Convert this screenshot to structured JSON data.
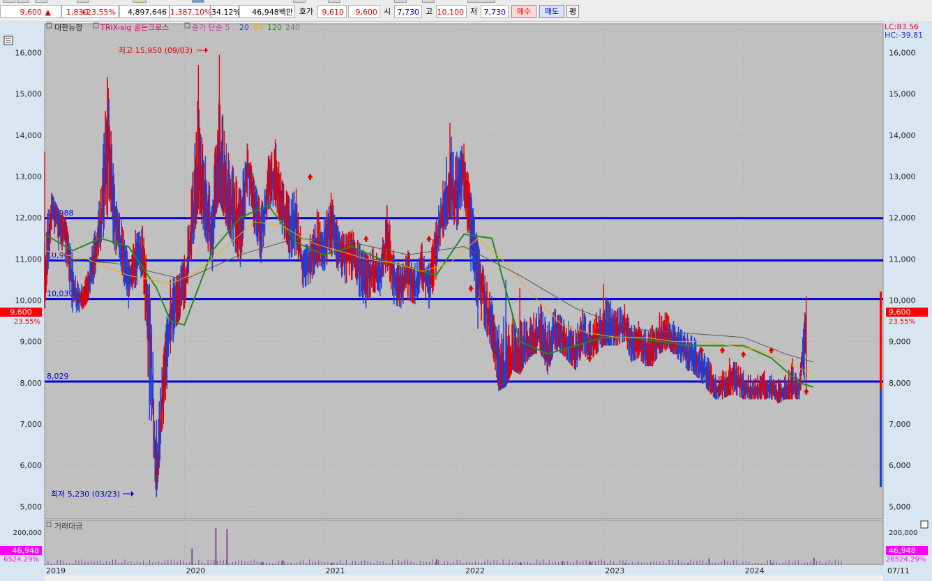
{
  "quote": {
    "price": "9,600",
    "arrow": "▲",
    "change": "1,830",
    "change_pct": "+23.55%",
    "volume": "4,897,646",
    "vol_ratio": "1,387.10%",
    "turnover_pct": "34.12%",
    "amount": "46,948백만",
    "hoga_label": "호가",
    "ask": "9,610",
    "bid": "9,600",
    "open_label": "시",
    "open": "7,730",
    "high_label": "고",
    "high": "10,100",
    "low_label": "저",
    "low": "7,730",
    "buy_label": "매수",
    "sell_label": "매도",
    "avg_label": "평"
  },
  "legend": {
    "group": "대한뉴팜",
    "trix": "TRIX-sig 골든크로스",
    "ma_label": "종가 단순 5",
    "ma20": "20",
    "ma60": "60",
    "ma120": "120",
    "ma240": "240"
  },
  "indicator": {
    "lc": "LC:83.56",
    "hc": "HC:-39.81"
  },
  "annotations": {
    "high": "최고 15,950 (09/03)",
    "low": "최저 5,230 (03/23)"
  },
  "hlines": [
    {
      "value": 11988,
      "label": "11,988"
    },
    {
      "value": 10964,
      "label": "10,964"
    },
    {
      "value": 10030,
      "label": "10,030"
    },
    {
      "value": 8029,
      "label": "8,029"
    }
  ],
  "price_tag": {
    "value": "9,600",
    "pct": "23.55%"
  },
  "volume_panel": {
    "title": "거래대금",
    "tag": "46,948",
    "pct": "6524.29%",
    "pct_right": "26524.29%",
    "ytick": "200,000"
  },
  "colors": {
    "up": "#e00000",
    "down": "#1a3fd8",
    "hline": "#0000dd",
    "ma5": "#2233cc",
    "ma20": "#f0b000",
    "ma60": "#228822",
    "ma120": "#555555",
    "panel_bg": "#c0c0c0",
    "axis_bg": "#d8e6f2",
    "tag_red": "#ff0000",
    "tag_magenta": "#ff00ff"
  },
  "chart_data": {
    "type": "candlestick-line",
    "yticks": [
      "5,000",
      "6,000",
      "7,000",
      "8,000",
      "9,000",
      "10,000",
      "11,000",
      "12,000",
      "13,000",
      "14,000",
      "15,000",
      "16,000"
    ],
    "ylim": [
      4700,
      16700
    ],
    "xlabels": [
      {
        "label": "2019",
        "x": 2019.0
      },
      {
        "label": "2020",
        "x": 2020.0
      },
      {
        "label": "2021",
        "x": 2021.0
      },
      {
        "label": "2022",
        "x": 2022.0
      },
      {
        "label": "2023",
        "x": 2023.0
      },
      {
        "label": "2024",
        "x": 2024.0
      },
      {
        "label": "07/11",
        "x": 2024.95
      }
    ],
    "xlim": [
      2019.0,
      2025.0
    ],
    "price": {
      "x": [
        2019.0,
        2019.05,
        2019.1,
        2019.15,
        2019.2,
        2019.25,
        2019.3,
        2019.35,
        2019.4,
        2019.45,
        2019.5,
        2019.55,
        2019.6,
        2019.65,
        2019.7,
        2019.75,
        2019.8,
        2019.85,
        2019.9,
        2019.95,
        2020.0,
        2020.05,
        2020.1,
        2020.15,
        2020.2,
        2020.22,
        2020.25,
        2020.3,
        2020.35,
        2020.4,
        2020.45,
        2020.5,
        2020.55,
        2020.6,
        2020.65,
        2020.7,
        2020.75,
        2020.8,
        2020.85,
        2020.9,
        2020.95,
        2021.0,
        2021.05,
        2021.1,
        2021.15,
        2021.2,
        2021.25,
        2021.3,
        2021.35,
        2021.4,
        2021.45,
        2021.5,
        2021.55,
        2021.6,
        2021.65,
        2021.7,
        2021.75,
        2021.8,
        2021.85,
        2021.9,
        2021.95,
        2022.0,
        2022.05,
        2022.1,
        2022.15,
        2022.2,
        2022.25,
        2022.3,
        2022.35,
        2022.4,
        2022.45,
        2022.5,
        2022.55,
        2022.6,
        2022.65,
        2022.7,
        2022.75,
        2022.8,
        2022.85,
        2022.9,
        2022.95,
        2023.0,
        2023.05,
        2023.1,
        2023.15,
        2023.2,
        2023.25,
        2023.3,
        2023.35,
        2023.4,
        2023.45,
        2023.5,
        2023.55,
        2023.6,
        2023.65,
        2023.7,
        2023.75,
        2023.8,
        2023.85,
        2023.9,
        2023.95,
        2024.0,
        2024.05,
        2024.1,
        2024.15,
        2024.2,
        2024.25,
        2024.3,
        2024.35,
        2024.4,
        2024.45,
        2024.5
      ],
      "y": [
        10100,
        12300,
        11900,
        11700,
        10300,
        10000,
        10200,
        10900,
        11800,
        14100,
        12000,
        11300,
        10500,
        10900,
        11200,
        9500,
        5500,
        8000,
        9600,
        10000,
        10300,
        11600,
        13100,
        12300,
        11400,
        12700,
        13400,
        12600,
        12100,
        11600,
        13300,
        12400,
        11600,
        12800,
        13000,
        12300,
        11800,
        11900,
        10700,
        10900,
        11400,
        11200,
        11900,
        11300,
        11100,
        11100,
        10800,
        10600,
        10700,
        10600,
        11500,
        10500,
        10400,
        10600,
        10300,
        10800,
        10300,
        11200,
        12200,
        12700,
        12400,
        13200,
        11800,
        10900,
        10000,
        9200,
        8400,
        8200,
        8600,
        8600,
        8900,
        9100,
        9300,
        8700,
        9300,
        9100,
        8900,
        8700,
        9200,
        8900,
        9100,
        9400,
        9300,
        9300,
        9400,
        8900,
        9000,
        8800,
        8800,
        9100,
        9200,
        9000,
        8900,
        8700,
        8600,
        8400,
        8200,
        7800,
        7900,
        8000,
        8100,
        7900,
        7800,
        7800,
        7900,
        7800,
        7700,
        7800,
        7900,
        7800,
        9600
      ],
      "high": [
        13600,
        12600,
        12200,
        12000,
        11000,
        10300,
        10600,
        11500,
        12700,
        15400,
        12800,
        12000,
        11000,
        11700,
        11800,
        10400,
        7100,
        8700,
        10500,
        10600,
        11100,
        12700,
        15700,
        13500,
        12300,
        13700,
        15950,
        13800,
        13200,
        12700,
        13800,
        12900,
        12300,
        13500,
        13900,
        12900,
        12500,
        12700,
        11200,
        11600,
        12200,
        12000,
        12600,
        11800,
        11600,
        11700,
        11400,
        11100,
        11300,
        11000,
        12300,
        11100,
        10800,
        11200,
        10900,
        11400,
        10900,
        11900,
        12900,
        14300,
        13600,
        13800,
        12600,
        11400,
        10600,
        10100,
        9400,
        10500,
        9600,
        10300,
        9500,
        9700,
        9900,
        9400,
        9800,
        9600,
        9500,
        9300,
        9800,
        9500,
        9700,
        10400,
        10000,
        9800,
        9900,
        9400,
        9500,
        9300,
        9400,
        9700,
        9700,
        9500,
        9300,
        9200,
        9100,
        8800,
        8600,
        8200,
        8300,
        8600,
        8500,
        8300,
        8200,
        8200,
        8300,
        8200,
        8100,
        8200,
        8600,
        8100,
        10100
      ],
      "low": [
        9800,
        11700,
        11200,
        10900,
        9700,
        9700,
        9900,
        10400,
        11200,
        12000,
        11200,
        10700,
        9800,
        10300,
        10600,
        7100,
        5230,
        7000,
        8700,
        9400,
        9800,
        11000,
        12200,
        11500,
        10700,
        12000,
        12400,
        11800,
        11300,
        10800,
        12500,
        11600,
        10900,
        12200,
        12300,
        11600,
        11000,
        11100,
        10300,
        10400,
        10800,
        10700,
        11100,
        10700,
        10400,
        10500,
        10100,
        9800,
        10200,
        10100,
        10800,
        9900,
        9800,
        10000,
        9900,
        10300,
        9800,
        10500,
        11500,
        12000,
        11700,
        12400,
        10700,
        9300,
        9300,
        8800,
        7800,
        7900,
        8300,
        8200,
        8500,
        8700,
        8700,
        8200,
        8800,
        8700,
        8500,
        8300,
        8700,
        8500,
        8700,
        8900,
        8900,
        8900,
        9000,
        8500,
        8600,
        8400,
        8400,
        8700,
        8800,
        8700,
        8500,
        8300,
        8200,
        8000,
        7800,
        7600,
        7600,
        7700,
        7700,
        7600,
        7600,
        7600,
        7600,
        7600,
        7500,
        7600,
        7600,
        7600,
        7730
      ]
    },
    "series": [
      {
        "name": "20",
        "x": [
          2019.0,
          2019.2,
          2019.4,
          2019.6,
          2019.8,
          2019.9,
          2020.0,
          2020.2,
          2020.4,
          2020.6,
          2020.8,
          2021.0,
          2021.2,
          2021.4,
          2021.6,
          2021.8,
          2022.0,
          2022.2,
          2022.4,
          2022.6,
          2022.8,
          2023.0,
          2023.2,
          2023.4,
          2023.6,
          2023.8,
          2024.0,
          2024.2,
          2024.4,
          2024.5
        ],
        "y": [
          11600,
          11200,
          11500,
          11300,
          10300,
          9500,
          9400,
          11200,
          12000,
          12300,
          11400,
          11100,
          11300,
          11000,
          10800,
          10600,
          11600,
          11500,
          9000,
          8700,
          8900,
          9100,
          9100,
          9000,
          8900,
          8900,
          8900,
          8600,
          8000,
          7900
        ]
      },
      {
        "name": "60",
        "x": [
          2019.0,
          2019.3,
          2019.6,
          2019.9,
          2020.1,
          2020.3,
          2020.5,
          2020.7,
          2020.9,
          2021.1,
          2021.3,
          2021.5,
          2021.7,
          2021.9,
          2022.1,
          2022.3,
          2022.5,
          2022.7,
          2022.9,
          2023.1,
          2023.3,
          2023.5,
          2023.7,
          2023.9,
          2024.1,
          2024.3,
          2024.5
        ],
        "y": [
          11200,
          11000,
          10600,
          10400,
          10700,
          11300,
          11900,
          11800,
          11400,
          11200,
          11000,
          10900,
          10700,
          10900,
          11500,
          10900,
          10100,
          9400,
          9200,
          9100,
          9100,
          9000,
          9000,
          8900,
          8800,
          8500,
          8200
        ]
      },
      {
        "name": "120",
        "x": [
          2019.0,
          2019.5,
          2020.0,
          2020.4,
          2020.8,
          2021.2,
          2021.6,
          2022.0,
          2022.4,
          2022.8,
          2023.2,
          2023.6,
          2024.0,
          2024.3,
          2024.5
        ],
        "y": [
          11000,
          10900,
          10500,
          11100,
          11500,
          11400,
          11100,
          11300,
          10600,
          9800,
          9300,
          9200,
          9100,
          8700,
          8500
        ]
      }
    ],
    "volume": {
      "x": [
        2020.05,
        2020.22,
        2020.3,
        2020.55,
        2020.7,
        2021.05,
        2021.8,
        2022.4,
        2022.7,
        2022.9,
        2023.15,
        2023.6,
        2023.75,
        2024.2,
        2024.5
      ],
      "y": [
        110000,
        250000,
        240000,
        22000,
        30000,
        15000,
        40000,
        18000,
        28000,
        20000,
        14000,
        15000,
        45000,
        12000,
        46948
      ]
    }
  }
}
